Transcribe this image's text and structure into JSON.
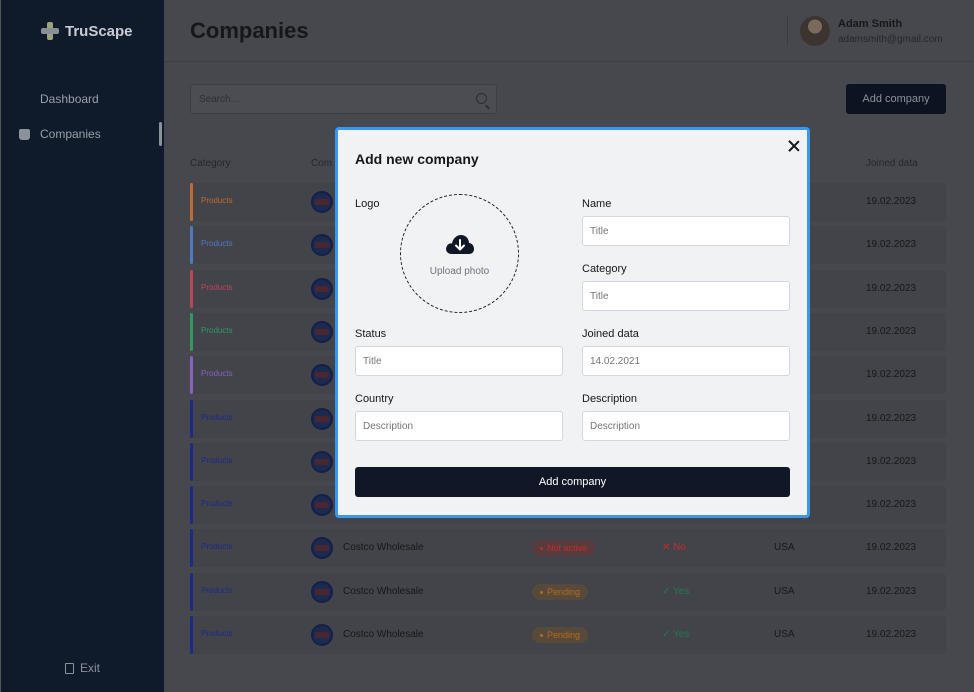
{
  "app": {
    "brand": "TruScape"
  },
  "sidebar": {
    "items": [
      {
        "label": "Dashboard",
        "icon": "grid-icon"
      },
      {
        "label": "Companies",
        "icon": "graduation-cap-icon"
      }
    ],
    "exit_label": "Exit"
  },
  "header": {
    "title": "Companies",
    "user": {
      "name": "Adam Smith",
      "email": "adamsmith@gmail.com"
    }
  },
  "toolbar": {
    "search_placeholder": "Search...",
    "add_button": "Add company"
  },
  "table": {
    "columns": {
      "category": "Category",
      "company": "Com",
      "joined": "Joined data"
    },
    "rows": [
      {
        "category": "Products",
        "accent": "#c26a2e",
        "company": "",
        "status": "",
        "active": "",
        "country": "",
        "date": "19.02.2023"
      },
      {
        "category": "Products",
        "accent": "#4f79c4",
        "company": "",
        "status": "",
        "active": "",
        "country": "",
        "date": "19.02.2023"
      },
      {
        "category": "Products",
        "accent": "#c0445a",
        "company": "",
        "status": "",
        "active": "",
        "country": "",
        "date": "19.02.2023"
      },
      {
        "category": "Products",
        "accent": "#2c9a63",
        "company": "",
        "status": "",
        "active": "",
        "country": "",
        "date": "19.02.2023"
      },
      {
        "category": "Products",
        "accent": "#8561c4",
        "company": "",
        "status": "",
        "active": "",
        "country": "",
        "date": "19.02.2023"
      },
      {
        "category": "Products",
        "accent": "#1b2a8c",
        "company": "",
        "status": "",
        "active": "",
        "country": "",
        "date": "19.02.2023"
      },
      {
        "category": "Products",
        "accent": "#1b2a8c",
        "company": "",
        "status": "",
        "active": "",
        "country": "",
        "date": "19.02.2023"
      },
      {
        "category": "Products",
        "accent": "#1b2a8c",
        "company": "",
        "status": "",
        "active": "",
        "country": "",
        "date": "19.02.2023"
      },
      {
        "category": "Products",
        "accent": "#1b2a8c",
        "company": "Costco Wholesale",
        "status": "Not active",
        "status_color": "#c22b2b",
        "status_bg": "#5a3b3d",
        "active": "✕ No",
        "active_color": "#c22b2b",
        "country": "USA",
        "date": "19.02.2023"
      },
      {
        "category": "Products",
        "accent": "#1b2a8c",
        "company": "Costco Wholesale",
        "status": "Pending",
        "status_color": "#b56a1e",
        "status_bg": "#574a3a",
        "active": "✓ Yes",
        "active_color": "#1f7a4a",
        "country": "USA",
        "date": "19.02.2023"
      },
      {
        "category": "Products",
        "accent": "#1b2a8c",
        "company": "Costco Wholesale",
        "status": "Pending",
        "status_color": "#b56a1e",
        "status_bg": "#574a3a",
        "active": "✓ Yes",
        "active_color": "#1f7a4a",
        "country": "USA",
        "date": "19.02.2023"
      }
    ]
  },
  "modal": {
    "title": "Add new company",
    "logo_label": "Logo",
    "upload_label": "Upload photo",
    "fields": {
      "name": {
        "label": "Name",
        "placeholder": "Title"
      },
      "category": {
        "label": "Category",
        "placeholder": "Title"
      },
      "status": {
        "label": "Status",
        "placeholder": "Title"
      },
      "joined": {
        "label": "Joined data",
        "placeholder": "14.02.2021"
      },
      "country": {
        "label": "Country",
        "placeholder": "Description"
      },
      "description": {
        "label": "Description",
        "placeholder": "Description"
      }
    },
    "submit": "Add company"
  }
}
